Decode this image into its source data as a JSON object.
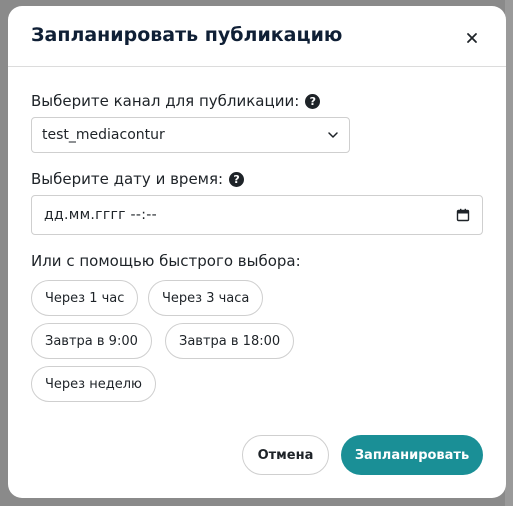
{
  "dialog": {
    "title": "Запланировать публикацию",
    "close_icon": "close-icon"
  },
  "channel": {
    "label": "Выберите канал для публикации:",
    "help_icon": "question-circle-icon",
    "selected": "test_mediacontur",
    "chevron_icon": "chevron-down-icon"
  },
  "datetime": {
    "label": "Выберите дату и время:",
    "help_icon": "question-circle-icon",
    "value": "дд.мм.гггг --:--",
    "calendar_icon": "calendar-icon"
  },
  "quick": {
    "label": "Или с помощью быстрого выбора:",
    "options": [
      "Через 1 час",
      "Через 3 часа",
      "Завтра в 9:00",
      "Завтра в 18:00",
      "Через неделю"
    ]
  },
  "actions": {
    "cancel": "Отмена",
    "submit": "Запланировать"
  },
  "colors": {
    "accent": "#1a8f96",
    "title": "#0f1f35"
  }
}
